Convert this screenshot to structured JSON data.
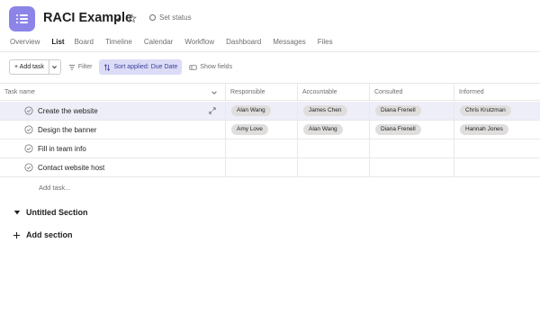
{
  "project": {
    "title": "RACI Example",
    "status_label": "Set status"
  },
  "tabs": [
    {
      "label": "Overview"
    },
    {
      "label": "List"
    },
    {
      "label": "Board"
    },
    {
      "label": "Timeline"
    },
    {
      "label": "Calendar"
    },
    {
      "label": "Workflow"
    },
    {
      "label": "Dashboard"
    },
    {
      "label": "Messages"
    },
    {
      "label": "Files"
    }
  ],
  "toolbar": {
    "add_task": "+ Add task",
    "filter": "Filter",
    "sort": "Sort applied: Due Date",
    "show_fields": "Show fields"
  },
  "table": {
    "headers": [
      "Task name",
      "Responsible",
      "Accountable",
      "Consulted",
      "Informed"
    ],
    "rows": [
      {
        "name": "Create the website",
        "responsible": "Alan Wang",
        "accountable": "James Chen",
        "consulted": "Diana Frenell",
        "informed": "Chris Krutzman"
      },
      {
        "name": "Design the banner",
        "responsible": "Amy Love",
        "accountable": "Alan Wang",
        "consulted": "Diana Frenell",
        "informed": "Hannah Jones"
      },
      {
        "name": "Fill in team info",
        "responsible": "",
        "accountable": "",
        "consulted": "",
        "informed": ""
      },
      {
        "name": "Contact website host",
        "responsible": "",
        "accountable": "",
        "consulted": "",
        "informed": ""
      }
    ],
    "add_task_label": "Add task..."
  },
  "section": {
    "name": "Untitled Section"
  },
  "add_section_label": "Add section",
  "colors": {
    "accent": "#8d84e8",
    "sort_bg": "#dcdcf7",
    "sort_text": "#3d3f9c",
    "selected_row": "#eeeef8"
  }
}
